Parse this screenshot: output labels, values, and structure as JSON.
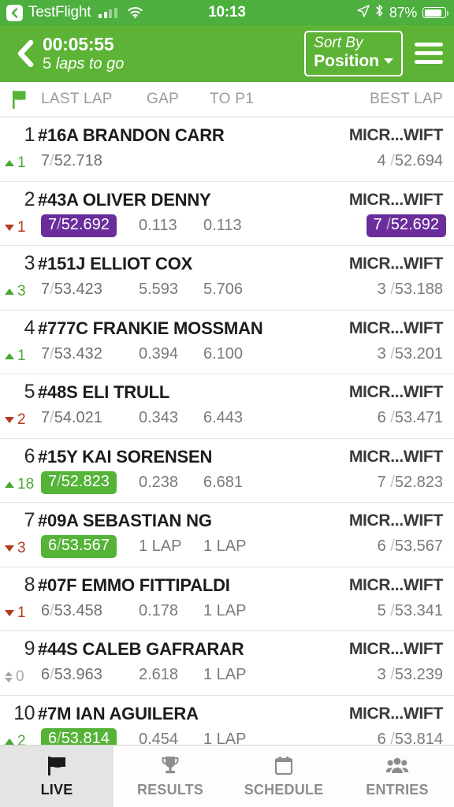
{
  "status_bar": {
    "back_app": "TestFlight",
    "time": "10:13",
    "battery_pct": "87%",
    "icons": [
      "back-chevron-icon",
      "cellular-signal-icon",
      "wifi-icon",
      "location-arrow-icon",
      "bluetooth-icon",
      "battery-icon"
    ]
  },
  "nav": {
    "back_icon": "back-chevron-icon",
    "timer": "00:05:55",
    "laps_count": "5",
    "laps_text": "laps to go",
    "sort_label": "Sort By",
    "sort_value": "Position",
    "menu_icon": "hamburger-menu-icon"
  },
  "columns": {
    "flag_icon": "green-flag-icon",
    "last_lap": "LAST LAP",
    "gap": "GAP",
    "to_p1": "TO P1",
    "best_lap": "BEST LAP"
  },
  "colors": {
    "header_green": "#5CB335",
    "status_green": "#4CAF3E",
    "badge_purple": "#6B2D9B",
    "badge_green": "#55B338",
    "up_green": "#4AA832",
    "down_red": "#B23B1E",
    "neutral_gray": "#A8A8A8"
  },
  "rows": [
    {
      "pos": "1",
      "name": "#16A BRANDON CARR",
      "team": "MICR...WIFT",
      "change_dir": "up",
      "change_val": "1",
      "last_lap_laps": "7",
      "last_lap_time": "52.718",
      "last_lap_badge": "none",
      "gap": "",
      "to_p1": "",
      "best_laps": "4",
      "best_time": "52.694",
      "best_badge": "none"
    },
    {
      "pos": "2",
      "name": "#43A OLIVER DENNY",
      "team": "MICR...WIFT",
      "change_dir": "down",
      "change_val": "1",
      "last_lap_laps": "7",
      "last_lap_time": "52.692",
      "last_lap_badge": "purple",
      "gap": "0.113",
      "to_p1": "0.113",
      "best_laps": "7",
      "best_time": "52.692",
      "best_badge": "purple"
    },
    {
      "pos": "3",
      "name": "#151J ELLIOT COX",
      "team": "MICR...WIFT",
      "change_dir": "up",
      "change_val": "3",
      "last_lap_laps": "7",
      "last_lap_time": "53.423",
      "last_lap_badge": "none",
      "gap": "5.593",
      "to_p1": "5.706",
      "best_laps": "3",
      "best_time": "53.188",
      "best_badge": "none"
    },
    {
      "pos": "4",
      "name": "#777C FRANKIE MOSSMAN",
      "team": "MICR...WIFT",
      "change_dir": "up",
      "change_val": "1",
      "last_lap_laps": "7",
      "last_lap_time": "53.432",
      "last_lap_badge": "none",
      "gap": "0.394",
      "to_p1": "6.100",
      "best_laps": "3",
      "best_time": "53.201",
      "best_badge": "none"
    },
    {
      "pos": "5",
      "name": "#48S ELI TRULL",
      "team": "MICR...WIFT",
      "change_dir": "down",
      "change_val": "2",
      "last_lap_laps": "7",
      "last_lap_time": "54.021",
      "last_lap_badge": "none",
      "gap": "0.343",
      "to_p1": "6.443",
      "best_laps": "6",
      "best_time": "53.471",
      "best_badge": "none"
    },
    {
      "pos": "6",
      "name": "#15Y KAI SORENSEN",
      "team": "MICR...WIFT",
      "change_dir": "up",
      "change_val": "18",
      "last_lap_laps": "7",
      "last_lap_time": "52.823",
      "last_lap_badge": "green",
      "gap": "0.238",
      "to_p1": "6.681",
      "best_laps": "7",
      "best_time": "52.823",
      "best_badge": "none"
    },
    {
      "pos": "7",
      "name": "#09A SEBASTIAN NG",
      "team": "MICR...WIFT",
      "change_dir": "down",
      "change_val": "3",
      "last_lap_laps": "6",
      "last_lap_time": "53.567",
      "last_lap_badge": "green",
      "gap": "1 LAP",
      "to_p1": "1 LAP",
      "best_laps": "6",
      "best_time": "53.567",
      "best_badge": "none"
    },
    {
      "pos": "8",
      "name": "#07F EMMO FITTIPALDI",
      "team": "MICR...WIFT",
      "change_dir": "down",
      "change_val": "1",
      "last_lap_laps": "6",
      "last_lap_time": "53.458",
      "last_lap_badge": "none",
      "gap": "0.178",
      "to_p1": "1 LAP",
      "best_laps": "5",
      "best_time": "53.341",
      "best_badge": "none"
    },
    {
      "pos": "9",
      "name": "#44S CALEB GAFRARAR",
      "team": "MICR...WIFT",
      "change_dir": "same",
      "change_val": "0",
      "last_lap_laps": "6",
      "last_lap_time": "53.963",
      "last_lap_badge": "none",
      "gap": "2.618",
      "to_p1": "1 LAP",
      "best_laps": "3",
      "best_time": "53.239",
      "best_badge": "none"
    },
    {
      "pos": "10",
      "name": "#7M IAN AGUILERA",
      "team": "MICR...WIFT",
      "change_dir": "up",
      "change_val": "2",
      "last_lap_laps": "6",
      "last_lap_time": "53.814",
      "last_lap_badge": "green",
      "gap": "0.454",
      "to_p1": "1 LAP",
      "best_laps": "6",
      "best_time": "53.814",
      "best_badge": "none"
    }
  ],
  "tabs": [
    {
      "label": "LIVE",
      "icon": "flag-icon",
      "active": true
    },
    {
      "label": "RESULTS",
      "icon": "trophy-icon",
      "active": false
    },
    {
      "label": "SCHEDULE",
      "icon": "calendar-icon",
      "active": false
    },
    {
      "label": "ENTRIES",
      "icon": "people-icon",
      "active": false
    }
  ]
}
